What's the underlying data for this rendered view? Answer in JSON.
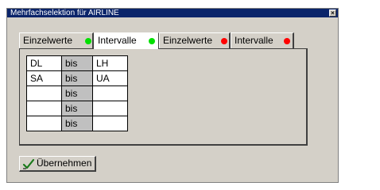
{
  "window": {
    "title": "Mehrfachselektion für AIRLINE",
    "close_glyph": "×"
  },
  "tabs": [
    {
      "label": "Einzelwerte",
      "status": "green",
      "status_color": "#00e000",
      "active": false
    },
    {
      "label": "Intervalle",
      "status": "green",
      "status_color": "#00e000",
      "active": true
    },
    {
      "label": "Einzelwerte",
      "status": "red",
      "status_color": "#ff0000",
      "active": false
    },
    {
      "label": "Intervalle",
      "status": "red",
      "status_color": "#ff0000",
      "active": false
    }
  ],
  "grid": {
    "rows": [
      {
        "from": "DL",
        "sep": "bis",
        "to": "LH"
      },
      {
        "from": "SA",
        "sep": "bis",
        "to": "UA"
      },
      {
        "from": "",
        "sep": "bis",
        "to": ""
      },
      {
        "from": "",
        "sep": "bis",
        "to": ""
      },
      {
        "from": "",
        "sep": "bis",
        "to": ""
      }
    ]
  },
  "footer": {
    "apply_label": "Übernehmen",
    "apply_icon": "checkmark-icon"
  }
}
